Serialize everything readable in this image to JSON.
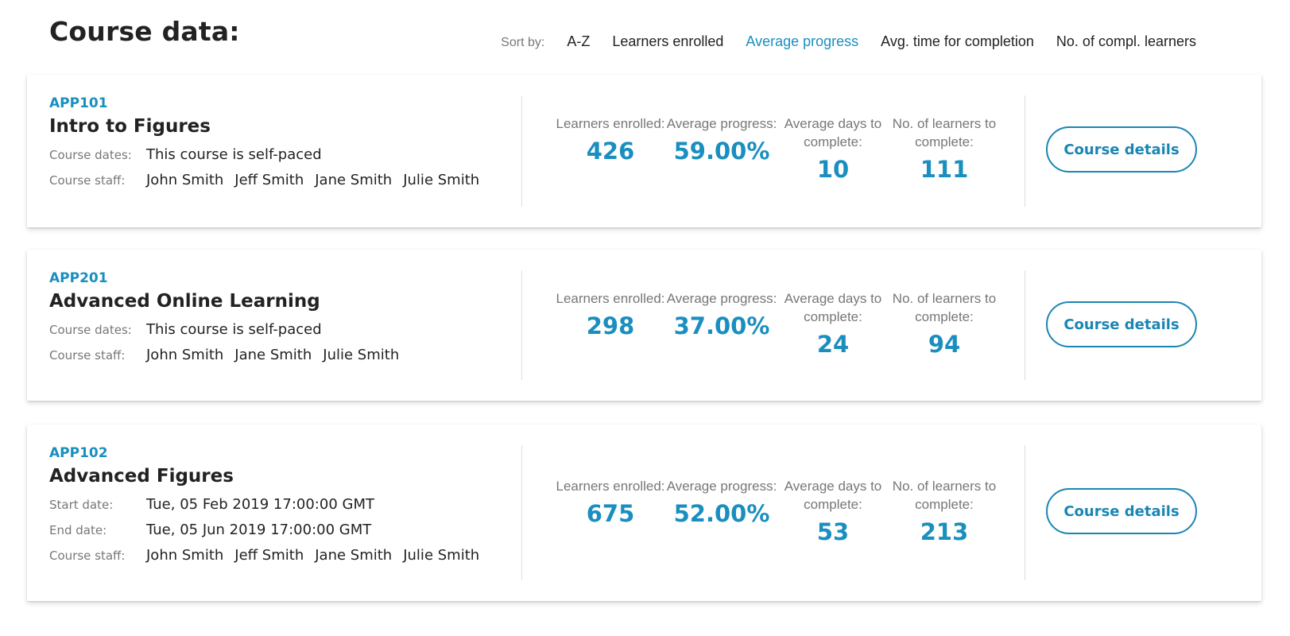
{
  "header": {
    "title": "Course data:",
    "sort_label": "Sort by:",
    "sort_options": [
      "A-Z",
      "Learners enrolled",
      "Average progress",
      "Avg. time for completion",
      "No. of compl. learners"
    ],
    "active_sort": "Average progress"
  },
  "colors": {
    "accent": "#1a8fbf",
    "text": "#222222",
    "muted": "#777777"
  },
  "stat_labels": {
    "enrolled": "Learners enrolled:",
    "progress": "Average progress:",
    "days": "Average days to complete:",
    "completed": "No. of learners to complete:"
  },
  "courses": [
    {
      "code": "APP101",
      "title": "Intro to Figures",
      "meta": [
        {
          "label": "Course dates:",
          "value": "This course is self-paced"
        }
      ],
      "staff_label": "Course staff:",
      "staff": [
        "John Smith",
        "Jeff Smith",
        "Jane Smith",
        "Julie Smith"
      ],
      "stats": {
        "enrolled": "426",
        "progress": "59.00%",
        "days": "10",
        "completed": "111"
      },
      "button": "Course details"
    },
    {
      "code": "APP201",
      "title": "Advanced Online Learning",
      "meta": [
        {
          "label": "Course dates:",
          "value": "This course is self-paced"
        }
      ],
      "staff_label": "Course staff:",
      "staff": [
        "John Smith",
        "Jane Smith",
        "Julie Smith"
      ],
      "stats": {
        "enrolled": "298",
        "progress": "37.00%",
        "days": "24",
        "completed": "94"
      },
      "button": "Course details"
    },
    {
      "code": "APP102",
      "title": "Advanced Figures",
      "meta": [
        {
          "label": "Start date:",
          "value": "Tue, 05 Feb 2019 17:00:00 GMT"
        },
        {
          "label": "End date:",
          "value": "Tue, 05 Jun 2019 17:00:00 GMT"
        }
      ],
      "staff_label": "Course staff:",
      "staff": [
        "John Smith",
        "Jeff Smith",
        "Jane Smith",
        "Julie Smith"
      ],
      "stats": {
        "enrolled": "675",
        "progress": "52.00%",
        "days": "53",
        "completed": "213"
      },
      "button": "Course details"
    }
  ]
}
